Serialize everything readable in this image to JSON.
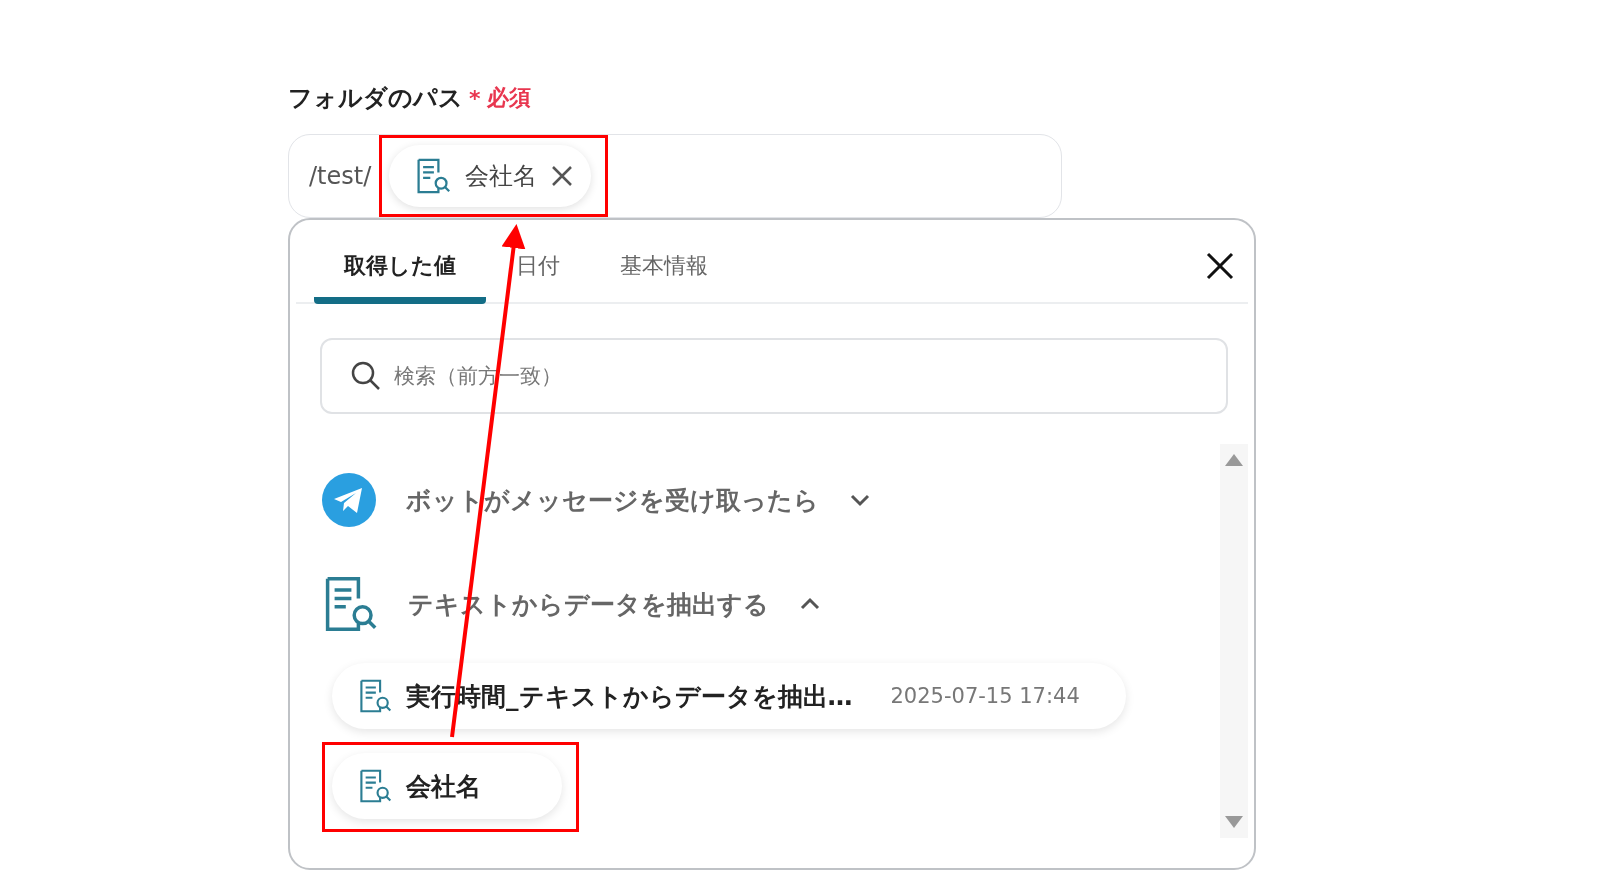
{
  "field": {
    "label": "フォルダのパス",
    "required_mark": "*",
    "required_text": "必須",
    "prefix": "/test/",
    "token": {
      "label": "会社名",
      "highlighted": true
    }
  },
  "tabs": [
    {
      "label": "取得した値",
      "selected": true
    },
    {
      "label": "日付",
      "selected": false
    },
    {
      "label": "基本情報",
      "selected": false
    }
  ],
  "search": {
    "placeholder": "検索（前方一致）"
  },
  "groups": [
    {
      "kind": "telegram",
      "title": "ボットがメッセージを受け取ったら",
      "expanded": false
    },
    {
      "kind": "document",
      "title": "テキストからデータを抽出する",
      "expanded": true,
      "items": [
        {
          "label": "実行時間_テキストからデータを抽出…",
          "time": "2025-07-15 17:44",
          "highlighted": false
        },
        {
          "label": "会社名",
          "highlighted": true
        }
      ]
    }
  ]
}
